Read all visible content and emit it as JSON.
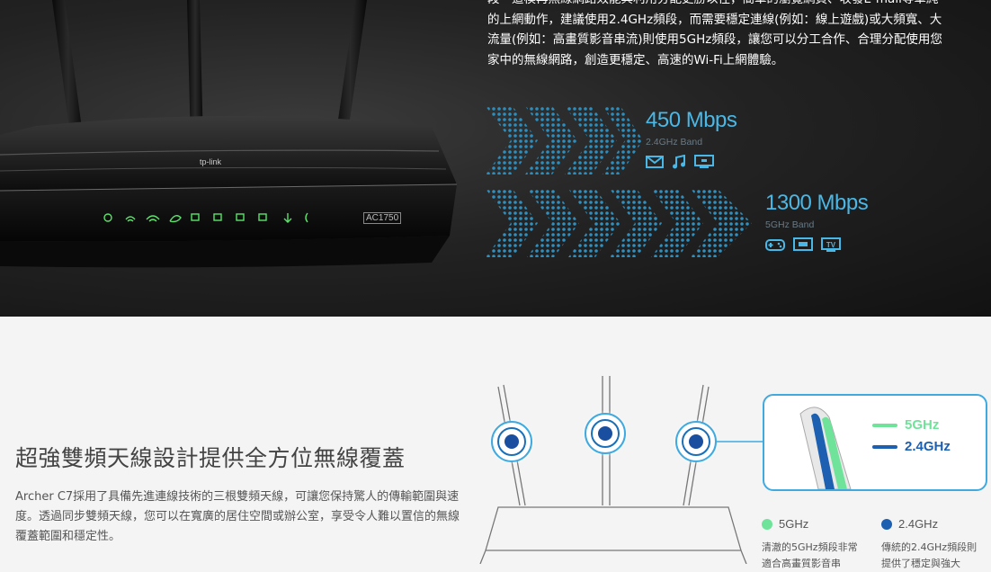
{
  "hero": {
    "paragraph": "段一道模再無線網路效能與利用分配更勝以往，簡單的瀏覽網頁、收發E-mail等單純的上網動作，建議使用2.4GHz頻段，而需要穩定連線(例如：線上遊戲)或大頻寬、大流量(例如：高畫質影音串流)則使用5GHz頻段，讓您可以分工合作、合理分配使用您家中的無線網路，創造更穩定、高速的Wi-Fi上網體驗。",
    "router_brand": "tp-link",
    "router_badge": "AC1750",
    "bands": [
      {
        "speed": "450 Mbps",
        "label": "2.4GHz Band",
        "icons": [
          "mail-icon",
          "music-icon",
          "monitor-icon"
        ]
      },
      {
        "speed": "1300 Mbps",
        "label": "5GHz Band",
        "icons": [
          "gamepad-icon",
          "media-player-icon",
          "tv-icon"
        ]
      }
    ],
    "tv_icon_text": "TV",
    "accent_color": "#49b8e6"
  },
  "section": {
    "title": "超強雙頻天線設計提供全方位無線覆蓋",
    "body": "Archer C7採用了具備先進連線技術的三根雙頻天線，可讓您保持驚人的傳輸範圍與速度。透過同步雙頻天線，您可以在寬廣的居住空間或辦公室，享受令人難以置信的無線覆蓋範圍和穩定性。"
  },
  "legend": {
    "items": [
      {
        "label": "5GHz",
        "color": "#6fe39a"
      },
      {
        "label": "2.4GHz",
        "color": "#1d5fb0"
      }
    ]
  },
  "notes": [
    {
      "label": "5GHz",
      "color": "#6fe39a",
      "text": "清澈的5GHz頻段非常適合高畫質影音串"
    },
    {
      "label": "2.4GHz",
      "color": "#1d5fb0",
      "text": "傳統的2.4GHz頻段則提供了穩定與強大"
    }
  ]
}
